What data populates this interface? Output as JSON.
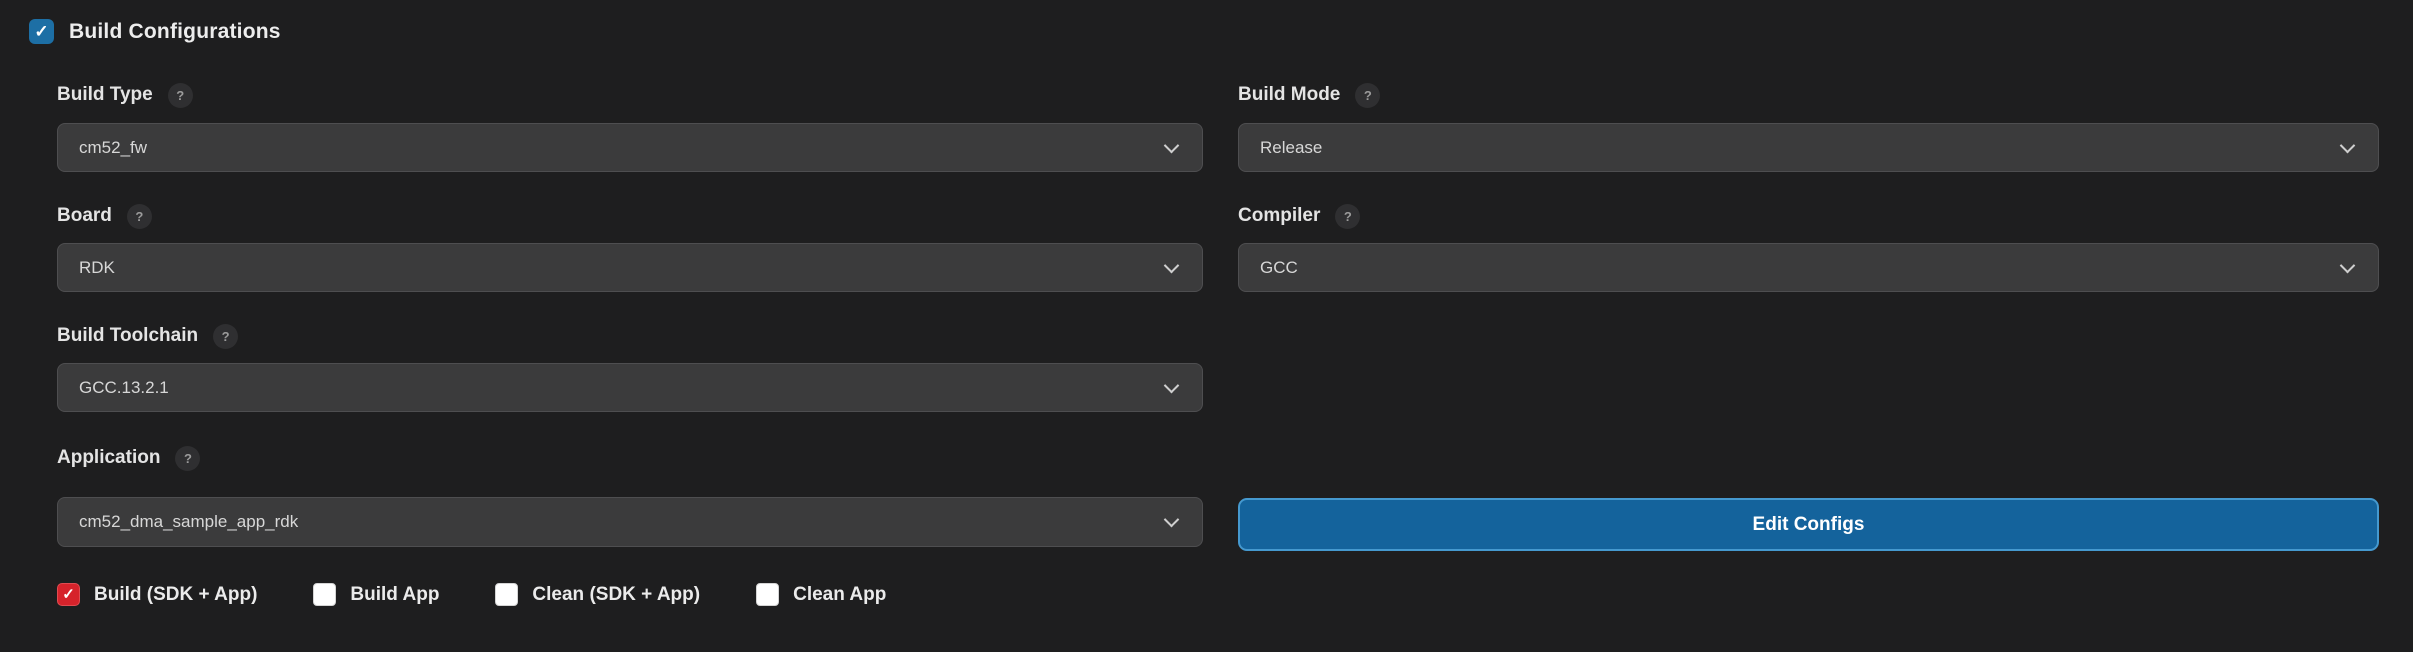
{
  "section": {
    "title": "Build Configurations",
    "checked": true
  },
  "icons": {
    "check": "✓",
    "help": "?"
  },
  "colors": {
    "accent_blue": "#14639c",
    "accent_blue_border": "#4599cf",
    "header_checkbox_blue": "#1d6fa5",
    "checked_red": "#d6232b",
    "dropdown_bg": "#3b3b3c",
    "page_bg": "#1e1e1f"
  },
  "fields": {
    "build_type": {
      "label": "Build Type",
      "value": "cm52_fw"
    },
    "build_mode": {
      "label": "Build Mode",
      "value": "Release"
    },
    "board": {
      "label": "Board",
      "value": "RDK"
    },
    "compiler": {
      "label": "Compiler",
      "value": "GCC"
    },
    "build_toolchain": {
      "label": "Build Toolchain",
      "value": "GCC.13.2.1"
    },
    "application": {
      "label": "Application",
      "value": "cm52_dma_sample_app_rdk"
    }
  },
  "actions": {
    "edit_configs": "Edit Configs"
  },
  "build_options": [
    {
      "label": "Build (SDK + App)",
      "checked": true
    },
    {
      "label": "Build App",
      "checked": false
    },
    {
      "label": "Clean (SDK + App)",
      "checked": false
    },
    {
      "label": "Clean App",
      "checked": false
    }
  ]
}
